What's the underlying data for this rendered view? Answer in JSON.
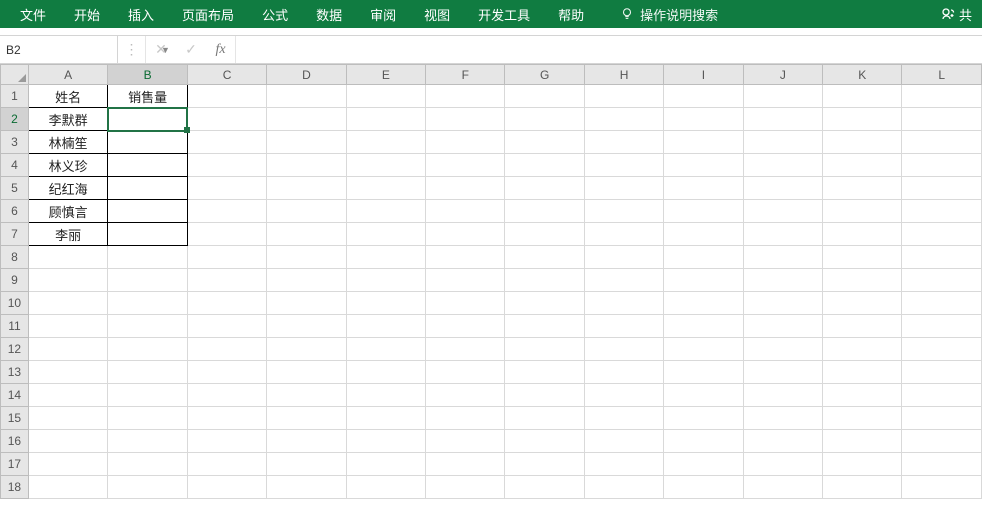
{
  "ribbon": {
    "tabs": [
      "文件",
      "开始",
      "插入",
      "页面布局",
      "公式",
      "数据",
      "审阅",
      "视图",
      "开发工具",
      "帮助"
    ],
    "tell_me": "操作说明搜索",
    "share_label": "共"
  },
  "formula_bar": {
    "name_box": "B2",
    "fx_label": "fx",
    "formula_value": ""
  },
  "grid": {
    "columns": [
      "A",
      "B",
      "C",
      "D",
      "E",
      "F",
      "G",
      "H",
      "I",
      "J",
      "K",
      "L"
    ],
    "row_count": 18,
    "active_cell": {
      "row": 2,
      "col": "B"
    },
    "data": {
      "A1": "姓名",
      "B1": "销售量",
      "A2": "李默群",
      "A3": "林楠笙",
      "A4": "林义珍",
      "A5": "纪红海",
      "A6": "顾慎言",
      "A7": "李丽"
    },
    "bordered_range": {
      "r1": 1,
      "r2": 7,
      "c1": "A",
      "c2": "B"
    }
  },
  "colors": {
    "ribbon_green": "#107c41",
    "selection_green": "#217346"
  }
}
